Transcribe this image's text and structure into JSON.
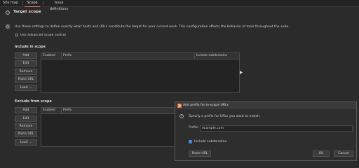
{
  "tabs": [
    {
      "label": "Site map"
    },
    {
      "label": "Scope"
    },
    {
      "label": "Issue definitions"
    }
  ],
  "target_scope": {
    "title": "Target scope",
    "description": "Use these settings to define exactly what hosts and URLs constitute the target for your current work. This configuration affects the behavior of tools throughout the suite.",
    "advanced_label": "Use advanced scope control"
  },
  "include": {
    "label": "Include in scope",
    "buttons": [
      "Add",
      "Edit",
      "Remove",
      "Paste URL",
      "Load ..."
    ],
    "columns": [
      "Enabled",
      "Prefix",
      "Include subdomains"
    ]
  },
  "exclude": {
    "label": "Exclude from scope",
    "buttons": [
      "Add",
      "Edit",
      "Remove",
      "Paste URL",
      "Load ..."
    ],
    "columns": [
      "Enabled",
      "Prefix"
    ]
  },
  "dialog": {
    "title": "Add prefix for in-scope URLs",
    "message": "Specify a prefix for URLs you want to match.",
    "prefix_label": "Prefix:",
    "prefix_value": "example.com",
    "include_subdomains_label": "Include subdomains",
    "paste_url": "Paste URL",
    "ok": "OK",
    "cancel": "Cancel"
  },
  "colors": {
    "accent": "#e8743b",
    "checkbox": "#3b7fd0"
  }
}
